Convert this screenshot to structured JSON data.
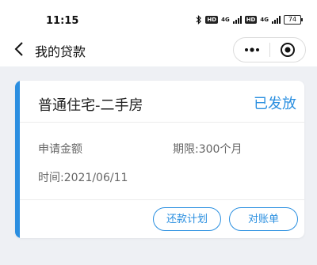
{
  "status_bar": {
    "time": "11:15",
    "hd_label": "HD",
    "network_label": "4G",
    "battery_level": "74"
  },
  "nav": {
    "title": "我的贷款",
    "back_icon": "chevron-left-icon",
    "more_icon": "ellipsis-icon",
    "close_icon": "target-icon"
  },
  "loan_card": {
    "title": "普通住宅-二手房",
    "status": "已发放",
    "amount_label": "申请金额",
    "term_label": "期限:300个月",
    "time_label": "时间:2021/06/11",
    "repayment_plan_button": "还款计划",
    "statement_button": "对账单"
  },
  "colors": {
    "accent": "#2a8fe0",
    "background": "#eef0f4"
  }
}
